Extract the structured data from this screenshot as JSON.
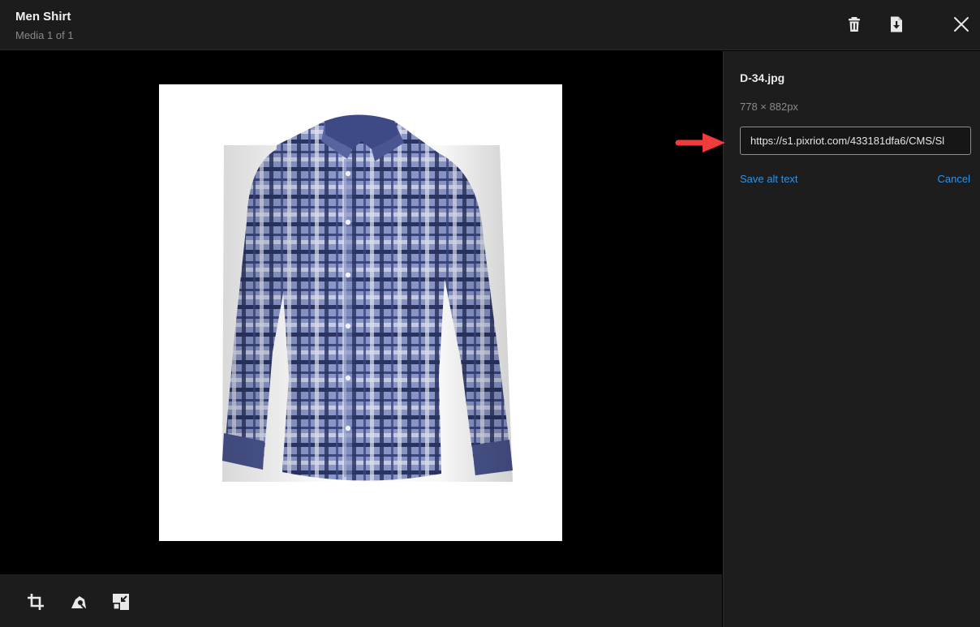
{
  "header": {
    "title": "Men Shirt",
    "subtitle": "Media 1 of 1",
    "actions": [
      {
        "name": "delete",
        "icon": "trash-icon"
      },
      {
        "name": "download",
        "icon": "download-icon"
      },
      {
        "name": "close",
        "icon": "close-icon"
      }
    ]
  },
  "media": {
    "subject": "blue plaid long-sleeve button-down shirt",
    "background": "#ffffff"
  },
  "toolbar": {
    "tools": [
      {
        "name": "crop",
        "icon": "crop-icon"
      },
      {
        "name": "focal-point",
        "icon": "focal-point-icon"
      },
      {
        "name": "resize",
        "icon": "resize-icon"
      }
    ]
  },
  "details": {
    "filename": "D-34.jpg",
    "dimensions": "778 × 882px",
    "alt_text_value": "https://s1.pixriot.com/433181dfa6/CMS/Sl",
    "save_label": "Save alt text",
    "cancel_label": "Cancel"
  },
  "annotation": {
    "arrow_color": "#ef3b3b",
    "points_to": "alt-text-input"
  },
  "colors": {
    "link": "#2c93ee",
    "chrome": "#1c1c1c",
    "stage": "#000000"
  }
}
